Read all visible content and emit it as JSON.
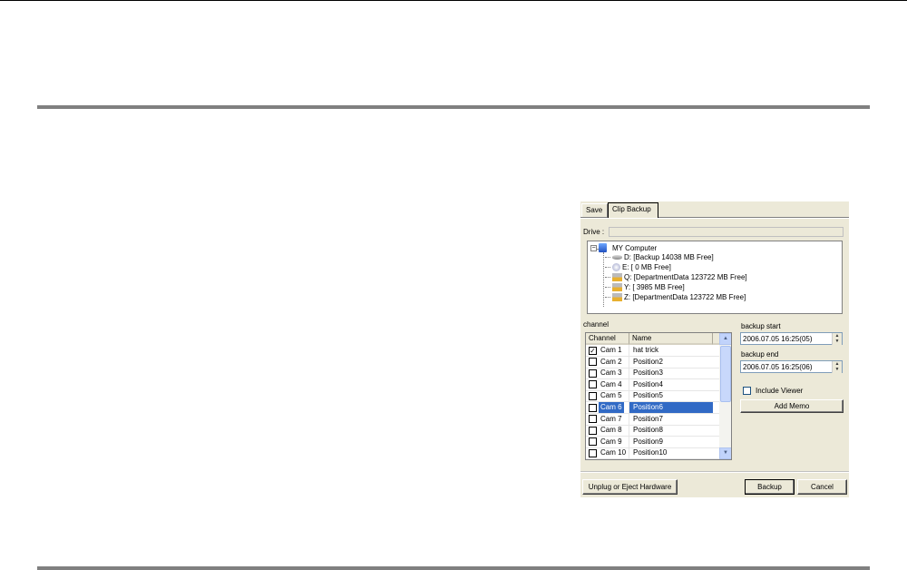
{
  "dialog": {
    "tabs": [
      {
        "label": "Save"
      },
      {
        "label": "Clip Backup"
      }
    ],
    "drive_label": "Drive :",
    "drive_value": "",
    "tree": {
      "root": "MY Computer",
      "items": [
        {
          "label": "D: [Backup 14038 MB Free]",
          "icon": "hard-drive-icon"
        },
        {
          "label": "E: [ 0 MB Free]",
          "icon": "cd-drive-icon"
        },
        {
          "label": "Q: [DepartmentData 123722 MB Free]",
          "icon": "network-drive-icon"
        },
        {
          "label": "Y: [ 3985 MB Free]",
          "icon": "network-drive-icon"
        },
        {
          "label": "Z: [DepartmentData 123722 MB Free]",
          "icon": "network-drive-icon"
        }
      ]
    },
    "channel_label": "channel",
    "columns": [
      "Channel",
      "Name"
    ],
    "channels": [
      {
        "channel": "Cam 1",
        "name": "hat trick",
        "checked": true,
        "selected": false
      },
      {
        "channel": "Cam 2",
        "name": "Position2",
        "checked": false,
        "selected": false
      },
      {
        "channel": "Cam 3",
        "name": "Position3",
        "checked": false,
        "selected": false
      },
      {
        "channel": "Cam 4",
        "name": "Position4",
        "checked": false,
        "selected": false
      },
      {
        "channel": "Cam 5",
        "name": "Position5",
        "checked": false,
        "selected": false
      },
      {
        "channel": "Cam 6",
        "name": "Position6",
        "checked": false,
        "selected": true
      },
      {
        "channel": "Cam 7",
        "name": "Position7",
        "checked": false,
        "selected": false
      },
      {
        "channel": "Cam 8",
        "name": "Position8",
        "checked": false,
        "selected": false
      },
      {
        "channel": "Cam 9",
        "name": "Position9",
        "checked": false,
        "selected": false
      },
      {
        "channel": "Cam 10",
        "name": "Position10",
        "checked": false,
        "selected": false
      }
    ],
    "backup_start_label": "backup start",
    "backup_start": "2006.07.05 16:25(05)",
    "backup_end_label": "backup end",
    "backup_end": "2006.07.05 16:25(06)",
    "include_viewer_label": "Include Viewer",
    "include_viewer": false,
    "add_memo": "Add Memo",
    "unplug": "Unplug or Eject Hardware",
    "backup": "Backup",
    "cancel": "Cancel",
    "selection_color": "#316ac5"
  }
}
